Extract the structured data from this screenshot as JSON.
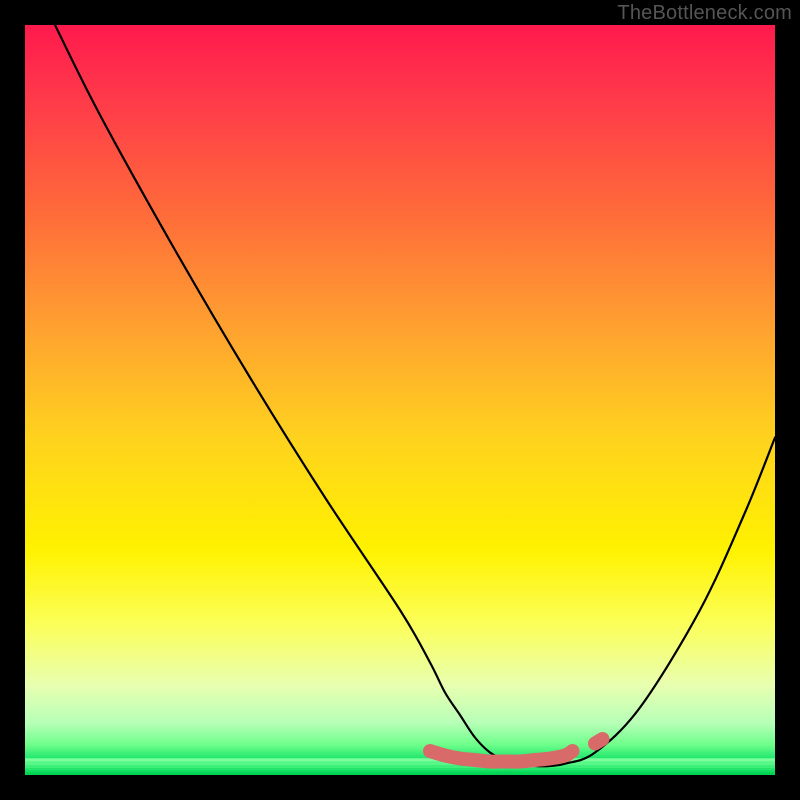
{
  "attribution": "TheBottleneck.com",
  "chart_data": {
    "type": "line",
    "title": "",
    "xlabel": "",
    "ylabel": "",
    "xlim": [
      0,
      100
    ],
    "ylim": [
      0,
      100
    ],
    "series": [
      {
        "name": "curve",
        "x": [
          4,
          10,
          20,
          30,
          40,
          50,
          54,
          56,
          58,
          60,
          62,
          64,
          66,
          68,
          70,
          72,
          76,
          82,
          90,
          96,
          100
        ],
        "values": [
          100,
          88,
          70,
          53,
          37,
          22,
          15,
          11,
          8,
          5,
          3,
          2,
          1.5,
          1.2,
          1.2,
          1.5,
          3,
          9,
          22,
          35,
          45
        ]
      }
    ],
    "highlight": {
      "name": "bottom-band",
      "x": [
        54,
        56,
        58,
        60,
        62,
        64,
        66,
        68,
        70,
        72,
        73
      ],
      "values": [
        3.2,
        2.6,
        2.2,
        2.0,
        1.8,
        1.8,
        1.8,
        2.0,
        2.2,
        2.6,
        3.2
      ]
    },
    "highlight2": {
      "name": "right-dot",
      "x": [
        76,
        77
      ],
      "values": [
        4.2,
        4.8
      ]
    },
    "green_stripes": [
      98.0,
      98.5,
      99.0,
      99.3,
      99.6,
      99.8,
      100.0
    ]
  }
}
